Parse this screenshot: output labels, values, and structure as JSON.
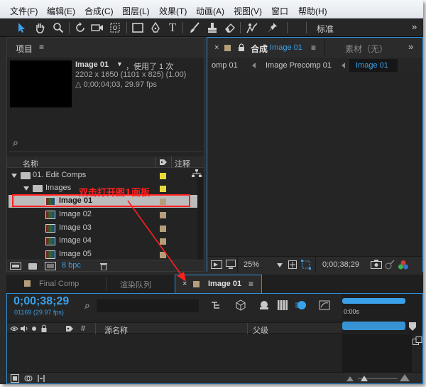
{
  "menubar": [
    "文件(F)",
    "编辑(E)",
    "合成(C)",
    "图层(L)",
    "效果(T)",
    "动画(A)",
    "视图(V)",
    "窗口",
    "帮助(H)"
  ],
  "toolbar": {
    "workspace_label": "标准",
    "workspace_more": "»"
  },
  "project_panel": {
    "tab_label": "项目",
    "menu_glyph": "≡",
    "selected_name": "Image 01",
    "dropdown_glyph": "▼",
    "usage": "，使用了 1 次",
    "dimensions": "2202 x 1650  (1101 x 825) (1.00)",
    "duration": "△ 0;00;04;03, 29.97 fps",
    "search_glyph": "⌕",
    "col_name": "名称",
    "col_comment": "注释",
    "items": [
      {
        "label": "01. Edit Comps",
        "type": "folder",
        "color": "#e6d83c"
      },
      {
        "label": "Images",
        "type": "folder",
        "color": "#e6d83c"
      },
      {
        "label": "Image 01",
        "type": "image",
        "color": "#b59f7a",
        "selected": true
      },
      {
        "label": "Image 02",
        "type": "image",
        "color": "#b59f7a"
      },
      {
        "label": "Image 03",
        "type": "image",
        "color": "#b59f7a"
      },
      {
        "label": "Image 04",
        "type": "image",
        "color": "#b59f7a"
      },
      {
        "label": "Image 05",
        "type": "image",
        "color": "#b59f7a"
      }
    ],
    "bpc": "8 bpc"
  },
  "comp_panel": {
    "close_glyph": "×",
    "lock_glyph": "🔒",
    "tab_label": "合成",
    "tab_value": "Image 01",
    "menu_glyph": "≡",
    "footage_tab": "素材（无）",
    "more_glyph": "»",
    "breadcrumbs": [
      "omp 01",
      "Image Precomp 01",
      "Image 01"
    ],
    "zoom": "25%",
    "timecode": "0;00;38;29"
  },
  "timeline": {
    "tabs": [
      "Final Comp",
      "渲染队列",
      "Image 01"
    ],
    "close_glyph": "×",
    "menu_glyph": "≡",
    "timecode": "0;00;38;29",
    "frame_info": "01169 (29.97 fps)",
    "search_glyph": "⌕",
    "ruler_start": "0:00s",
    "col_hash": "#",
    "col_source": "源名称",
    "col_parent": "父级"
  },
  "annotation": {
    "text": "双击打开图1面板",
    "color": "#ff2020"
  },
  "colors": {
    "accent": "#2f8fd8",
    "label_yellow": "#e6d83c",
    "label_tan": "#b59f7a",
    "timecode_blue": "#3aa0e8"
  }
}
